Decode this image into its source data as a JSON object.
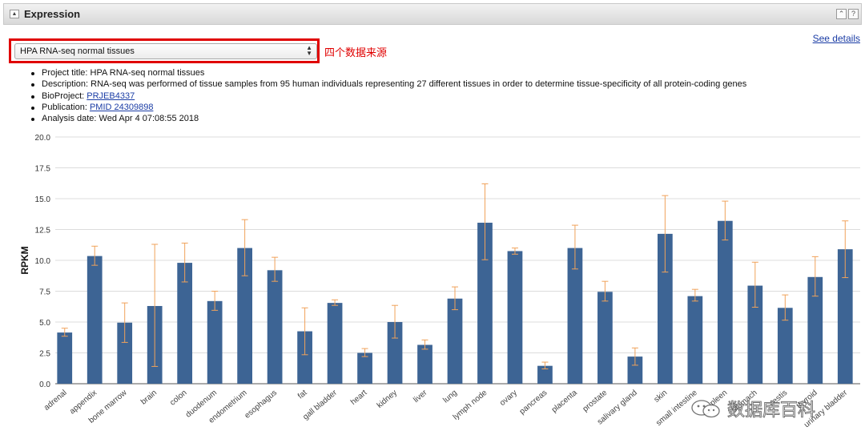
{
  "panel": {
    "title": "Expression",
    "collapse_icon": "triangle-up",
    "help_icon": "question-mark",
    "expand_icon": "double-chevron-up"
  },
  "see_details": "See details",
  "dataset_select": {
    "selected": "HPA RNA-seq normal tissues"
  },
  "annotation": {
    "text": "四个数据来源",
    "color": "#e00000"
  },
  "info": {
    "project_label": "Project title:",
    "project_value": "HPA RNA-seq normal tissues",
    "description_label": "Description:",
    "description_value": "RNA-seq was performed of tissue samples from 95 human individuals representing 27 different tissues in order to determine tissue-specificity of all protein-coding genes",
    "bioproject_label": "BioProject:",
    "bioproject_value": "PRJEB4337",
    "publication_label": "Publication:",
    "publication_value": "PMID 24309898",
    "analysis_label": "Analysis date:",
    "analysis_value": "Wed Apr 4 07:08:55 2018"
  },
  "watermark": {
    "text": "数据库百科"
  },
  "chart_data": {
    "type": "bar",
    "title": "",
    "xlabel": "",
    "ylabel": "RPKM",
    "ylim": [
      0,
      20
    ],
    "yticks": [
      0,
      2.5,
      5,
      7.5,
      10,
      12.5,
      15,
      17.5,
      20
    ],
    "ytick_labels": [
      "0.0",
      "2.5",
      "5.0",
      "7.5",
      "10.0",
      "12.5",
      "15.0",
      "17.5",
      "20.0"
    ],
    "grid": true,
    "bar_color": "#3d6494",
    "error_color": "#f0a25a",
    "categories": [
      "adrenal",
      "appendix",
      "bone marrow",
      "brain",
      "colon",
      "duodenum",
      "endometrium",
      "esophagus",
      "fat",
      "gall bladder",
      "heart",
      "kidney",
      "liver",
      "lung",
      "lymph node",
      "ovary",
      "pancreas",
      "placenta",
      "prostate",
      "salivary gland",
      "skin",
      "small intestine",
      "spleen",
      "stomach",
      "testis",
      "thyroid",
      "urinary bladder"
    ],
    "values": [
      4.15,
      10.35,
      4.95,
      6.3,
      9.8,
      6.7,
      11.0,
      9.2,
      4.25,
      6.55,
      2.5,
      5.0,
      3.15,
      6.9,
      13.05,
      10.75,
      1.45,
      11.0,
      7.45,
      2.2,
      12.15,
      7.1,
      13.2,
      7.95,
      6.15,
      8.65,
      10.9
    ],
    "err_low": [
      3.85,
      9.6,
      3.35,
      1.4,
      8.25,
      5.95,
      8.75,
      8.3,
      2.35,
      6.35,
      2.2,
      3.7,
      2.8,
      6.0,
      10.05,
      10.5,
      1.2,
      9.3,
      6.7,
      1.5,
      9.05,
      6.7,
      11.65,
      6.2,
      5.15,
      7.1,
      8.6
    ],
    "err_high": [
      4.5,
      11.15,
      6.55,
      11.3,
      11.4,
      7.5,
      13.3,
      10.25,
      6.15,
      6.8,
      2.85,
      6.35,
      3.55,
      7.85,
      16.2,
      11.0,
      1.75,
      12.85,
      8.3,
      2.9,
      15.25,
      7.65,
      14.8,
      9.85,
      7.2,
      10.3,
      13.2
    ]
  }
}
